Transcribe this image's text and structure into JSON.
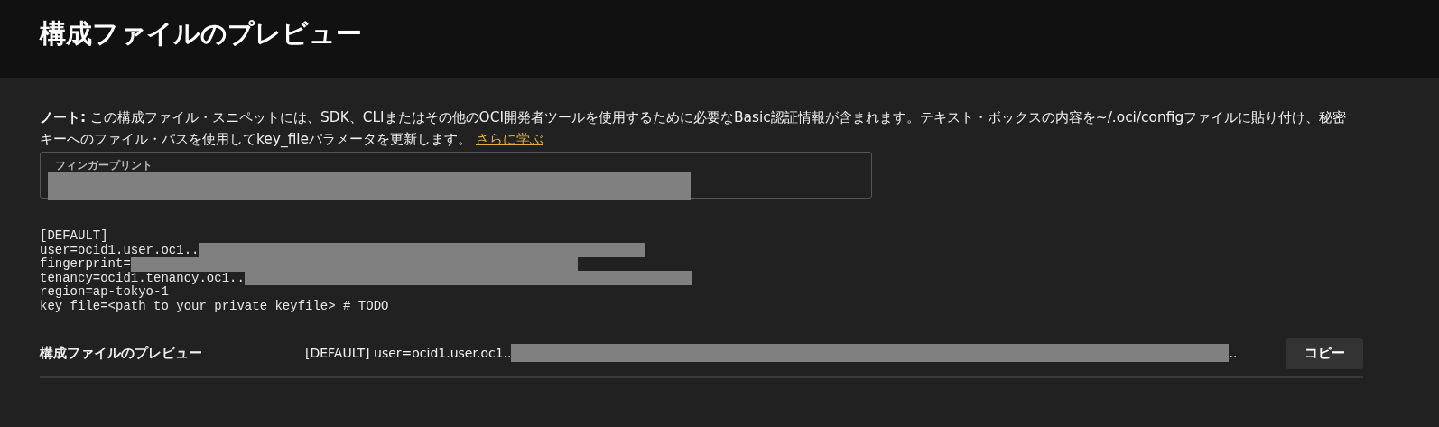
{
  "header": {
    "title": "構成ファイルのプレビュー"
  },
  "note": {
    "text": "**ノート:** この構成ファイル・スニペットには、SDK、CLIまたはその他のOCI開発者ツールを使用するために必要なBasic認証情報が含まれます。テキスト・ボックスの内容を~/.oci/configファイルに貼り付け、秘密キーへのファイル・パスを使用してkey_fileパラメータを更新します。",
    "link": "さらに学ぶ"
  },
  "fingerprint_field": {
    "label": "フィンガープリント"
  },
  "config_lines": [
    {
      "text": "[DEFAULT]",
      "redacted": false
    },
    {
      "text": "user=ocid1.user.oc1..",
      "redacted": true
    },
    {
      "text": "fingerprint=",
      "redacted": true
    },
    {
      "text": "tenancy=ocid1.tenancy.oc1..",
      "redacted": true
    },
    {
      "text": "region=ap-tokyo-1",
      "redacted": false
    },
    {
      "text": "key_file=<path to your private keyfile> # TODO",
      "redacted": false
    }
  ],
  "preview_row": {
    "label": "構成ファイルのプレビュー",
    "value_start": "[DEFAULT] user=ocid1.user.oc1..",
    "value_end": "..",
    "button": "コピー"
  }
}
